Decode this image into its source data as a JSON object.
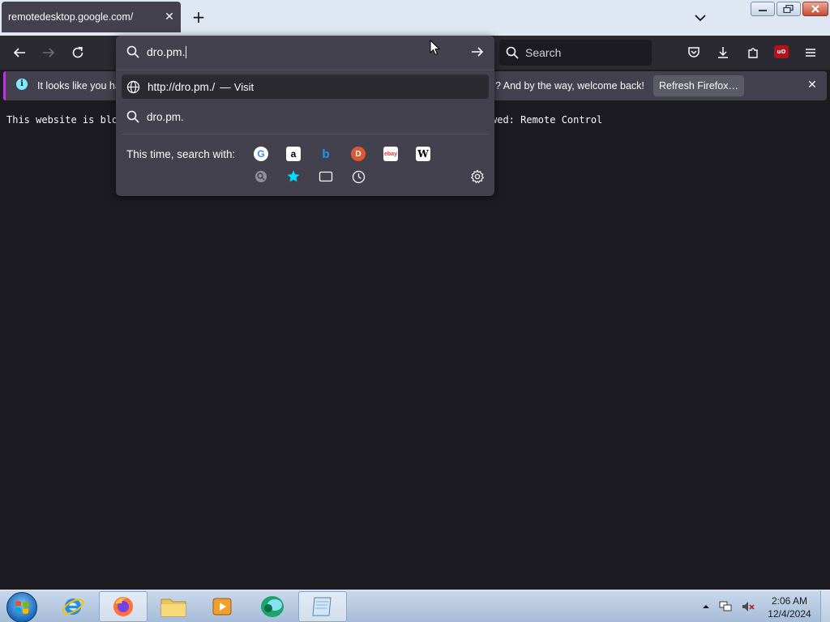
{
  "tab": {
    "title": "remotedesktop.google.com/",
    "close_glyph": "✕"
  },
  "newtab_glyph": "+",
  "toolbar": {
    "search_placeholder": "Search"
  },
  "urlbar": {
    "value": "dro.pm.",
    "suggestions": [
      {
        "text": "http://dro.pm./",
        "separator": "—",
        "action": "Visit",
        "icon": "globe-icon",
        "selected": true
      },
      {
        "text": "dro.pm.",
        "icon": "search-icon",
        "selected": false
      }
    ],
    "oneoff_label": "This time, search with:",
    "engines": [
      {
        "name": "google-engine-icon",
        "glyph": "G",
        "color": "#4285f4",
        "bg": "#ffffff"
      },
      {
        "name": "amazon-engine-icon",
        "glyph": "a",
        "color": "#000000",
        "bg": "#ffffff"
      },
      {
        "name": "bing-engine-icon",
        "glyph": "b",
        "color": "#1a9bf0",
        "bg": "transparent"
      },
      {
        "name": "duckduckgo-engine-icon",
        "glyph": "D",
        "color": "#ffffff",
        "bg": "#de5833"
      },
      {
        "name": "ebay-engine-icon",
        "glyph": "ebay",
        "color": "#e53238",
        "bg": "#ffffff"
      },
      {
        "name": "wikipedia-engine-icon",
        "glyph": "W",
        "color": "#000000",
        "bg": "#ffffff"
      }
    ],
    "modes": [
      {
        "name": "search-engine-icon"
      },
      {
        "name": "bookmarks-star-icon"
      },
      {
        "name": "tabs-icon"
      },
      {
        "name": "history-clock-icon"
      }
    ]
  },
  "notification": {
    "text_left": "It looks like you ha",
    "text_right": "? And by the way, welcome back!",
    "button": "Refresh Firefox…",
    "close_glyph": "✕",
    "info_glyph": "i"
  },
  "page": {
    "text_left": "This website is blo",
    "text_right": "wed: Remote Control"
  },
  "taskbar": {
    "apps": [
      "internet-explorer",
      "firefox",
      "file-explorer",
      "media-player",
      "remote-app",
      "notepad-app"
    ],
    "time": "2:06 AM",
    "date": "12/4/2024"
  },
  "colors": {
    "accent": "#b33dcf",
    "info": "#80ebff",
    "bg": "#1c1b22",
    "toolbar": "#2b2a33",
    "popup": "#42414d"
  }
}
